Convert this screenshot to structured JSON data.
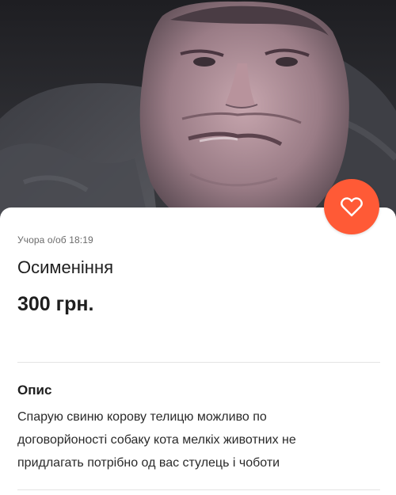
{
  "listing": {
    "posted": "Учора о/об 18:19",
    "title": "Осименіння",
    "price": "300 грн."
  },
  "description": {
    "heading": "Опис",
    "lines": [
      "Спарую свиню корову телицю можливо по",
      "договорйоності собаку кота мелкіх животних не",
      "придлагать потрібно од вас стулець і чоботи"
    ]
  },
  "favorite": {
    "icon": "heart-icon",
    "color": "#ff5a36"
  },
  "colors": {
    "accent": "#ff5a36",
    "text": "#1e1e1e",
    "muted": "#6b6b6b"
  }
}
